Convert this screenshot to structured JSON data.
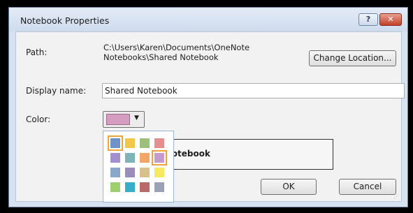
{
  "dialog": {
    "title": "Notebook Properties",
    "help_label": "?",
    "close_label": "✕"
  },
  "path": {
    "label": "Path:",
    "value_line1": "C:\\Users\\Karen\\Documents\\OneNote",
    "value_line2": "Notebooks\\Shared Notebook",
    "change_button": "Change Location..."
  },
  "display_name": {
    "label": "Display name:",
    "value": "Shared Notebook"
  },
  "color": {
    "label": "Color:",
    "selected": "#d59ec0",
    "palette": [
      [
        "#6d93c9",
        "#f2c84b",
        "#9ebf7e",
        "#e58f8f"
      ],
      [
        "#a48fd0",
        "#7fb5b8",
        "#f2a568",
        "#c59bd0"
      ],
      [
        "#8aa7c9",
        "#9a8dbb",
        "#d9c18e",
        "#f5e95e"
      ],
      [
        "#9fd06f",
        "#3aaec8",
        "#b86a6a",
        "#9aa2b6"
      ]
    ]
  },
  "preview_text": "d Notebook",
  "buttons": {
    "ok": "OK",
    "cancel": "Cancel"
  }
}
